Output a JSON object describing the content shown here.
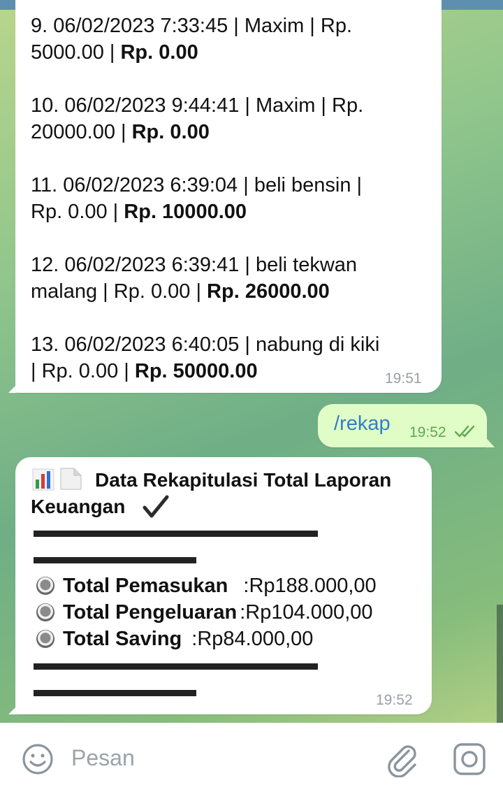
{
  "messages": [
    {
      "id": "msg-in-1",
      "entries": [
        {
          "line1": "9. 06/02/2023 7:33:45 | Maxim | Rp.",
          "line2_plain": "5000.00 | ",
          "line2_bold": "Rp. 0.00"
        },
        {
          "line1": "10. 06/02/2023 9:44:41 | Maxim | Rp.",
          "line2_plain": "20000.00 | ",
          "line2_bold": "Rp. 0.00"
        },
        {
          "line1": "11. 06/02/2023 6:39:04 | beli bensin |",
          "line2_plain": "Rp. 0.00 | ",
          "line2_bold": "Rp. 10000.00"
        },
        {
          "line1": "12. 06/02/2023 6:39:41 | beli tekwan",
          "line2_plain": "malang | Rp. 0.00 | ",
          "line2_bold": "Rp. 26000.00"
        },
        {
          "line1": "13. 06/02/2023 6:40:05 | nabung di kiki",
          "line2_plain": "| Rp. 0.00 | ",
          "line2_bold": "Rp. 50000.00"
        }
      ],
      "time": "19:51"
    },
    {
      "id": "msg-out-1",
      "text": "/rekap",
      "time": "19:52"
    },
    {
      "id": "msg-in-2",
      "title_line1": "Data Rekapitulasi Total Laporan",
      "title_line2": "Keuangan",
      "dash_line1": "▬▬▬▬▬▬▬▬▬▬▬▬▬▬",
      "dash_line2": "▬▬▬▬▬▬▬▬",
      "rows": [
        {
          "label": "Total Pemasukan",
          "value": ":Rp188.000,00"
        },
        {
          "label": "Total Pengeluaran",
          "value": ":Rp104.000,00"
        },
        {
          "label": "Total Saving",
          "value": ":Rp84.000,00"
        }
      ],
      "time": "19:52"
    }
  ],
  "input": {
    "placeholder": "Pesan"
  },
  "icons": {
    "emoji": "smiley-icon",
    "attach": "paperclip-icon",
    "camera": "camera-icon",
    "ticks": "double-check-icon",
    "chart": "bar-chart-icon",
    "document": "document-icon",
    "check": "checkmark-icon",
    "radio": "radio-button-icon"
  },
  "colors": {
    "outgoing_bubble": "#e1fdc7",
    "link_blue": "#2f7fc4",
    "time_green": "#5ca852"
  }
}
